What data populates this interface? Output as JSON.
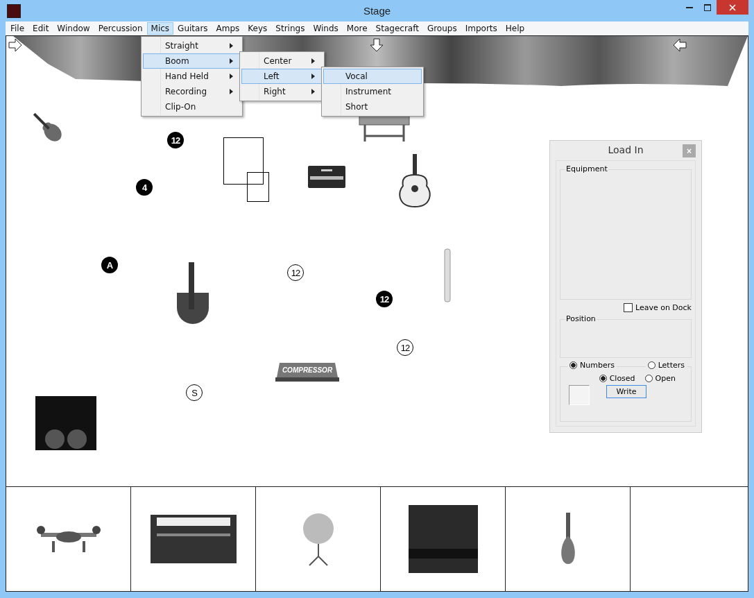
{
  "window": {
    "title": "Stage"
  },
  "menubar": [
    {
      "label": "File",
      "selected": false
    },
    {
      "label": "Edit",
      "selected": false
    },
    {
      "label": "Window",
      "selected": false
    },
    {
      "label": "Percussion",
      "selected": false
    },
    {
      "label": "Mics",
      "selected": true
    },
    {
      "label": "Guitars",
      "selected": false
    },
    {
      "label": "Amps",
      "selected": false
    },
    {
      "label": "Keys",
      "selected": false
    },
    {
      "label": "Strings",
      "selected": false
    },
    {
      "label": "Winds",
      "selected": false
    },
    {
      "label": "More",
      "selected": false
    },
    {
      "label": "Stagecraft",
      "selected": false
    },
    {
      "label": "Groups",
      "selected": false
    },
    {
      "label": "Imports",
      "selected": false
    },
    {
      "label": "Help",
      "selected": false
    }
  ],
  "menus": [
    {
      "items": [
        {
          "label": "Straight",
          "selected": false,
          "submenu": true
        },
        {
          "label": "Boom",
          "selected": true,
          "submenu": true
        },
        {
          "label": "Hand Held",
          "selected": false,
          "submenu": true
        },
        {
          "label": "Recording",
          "selected": false,
          "submenu": true
        },
        {
          "label": "Clip-On",
          "selected": false,
          "submenu": false
        }
      ]
    },
    {
      "items": [
        {
          "label": "Center",
          "selected": false,
          "submenu": true
        },
        {
          "label": "Left",
          "selected": true,
          "submenu": true
        },
        {
          "label": "Right",
          "selected": false,
          "submenu": true
        }
      ]
    },
    {
      "items": [
        {
          "label": "Vocal",
          "selected": true,
          "submenu": false
        },
        {
          "label": "Instrument",
          "selected": false,
          "submenu": false
        },
        {
          "label": "Short",
          "selected": false,
          "submenu": false
        }
      ]
    }
  ],
  "stage": {
    "markers": [
      {
        "label": "12",
        "filled": true
      },
      {
        "label": "4",
        "filled": true
      },
      {
        "label": "A",
        "filled": true
      },
      {
        "label": "12",
        "filled": false
      },
      {
        "label": "12",
        "filled": true
      },
      {
        "label": "12",
        "filled": false
      },
      {
        "label": "S",
        "filled": false
      }
    ],
    "compressor_label": "COMPRESSOR"
  },
  "load_in": {
    "title": "Load In",
    "close": "×",
    "equipment_label": "Equipment",
    "leave_on_dock": {
      "label": "Leave on Dock",
      "checked": false
    },
    "position_label": "Position",
    "radios": [
      {
        "label": "Numbers",
        "selected": true
      },
      {
        "label": "Letters",
        "selected": false
      },
      {
        "label": "Closed",
        "selected": true
      },
      {
        "label": "Open",
        "selected": false
      }
    ],
    "write_button": "Write"
  }
}
